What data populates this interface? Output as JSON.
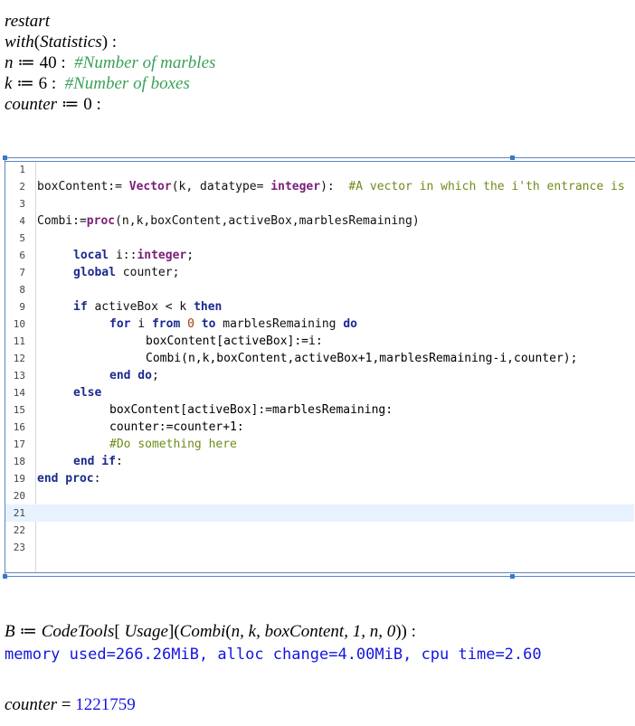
{
  "worksheet": {
    "line_restart": "restart",
    "line_with_cmd": "with",
    "line_with_arg": "Statistics",
    "n_var": "n",
    "n_val": "40",
    "n_comment": "#Number of marbles",
    "k_var": "k",
    "k_val": "6",
    "k_comment": "#Number of boxes",
    "counter_var": "counter",
    "counter_val": "0"
  },
  "code_editor": {
    "lines": [
      {
        "num": "1"
      },
      {
        "num": "2"
      },
      {
        "num": "3"
      },
      {
        "num": "4"
      },
      {
        "num": "5"
      },
      {
        "num": "6"
      },
      {
        "num": "7"
      },
      {
        "num": "8"
      },
      {
        "num": "9"
      },
      {
        "num": "10"
      },
      {
        "num": "11"
      },
      {
        "num": "12"
      },
      {
        "num": "13"
      },
      {
        "num": "14"
      },
      {
        "num": "15"
      },
      {
        "num": "16"
      },
      {
        "num": "17"
      },
      {
        "num": "18"
      },
      {
        "num": "19"
      },
      {
        "num": "20"
      },
      {
        "num": "21"
      },
      {
        "num": "22"
      },
      {
        "num": "23"
      }
    ],
    "l2_a": "boxContent:= ",
    "l2_b": "Vector",
    "l2_c": "(k, datatype= ",
    "l2_d": "integer",
    "l2_e": "):  ",
    "l2_f": "#A vector in which the i'th entrance is",
    "l4_a": "Combi:=",
    "l4_b": "proc",
    "l4_c": "(n,k,boxContent,activeBox,marblesRemaining)",
    "l6_a": "local",
    "l6_b": " i::",
    "l6_c": "integer",
    "l6_d": ";",
    "l7_a": "global",
    "l7_b": " counter;",
    "l9_a": "if",
    "l9_b": " activeBox < k ",
    "l9_c": "then",
    "l10_a": "for",
    "l10_b": " i ",
    "l10_c": "from",
    "l10_d": " 0 ",
    "l10_e": "to",
    "l10_f": " marblesRemaining ",
    "l10_g": "do",
    "l11_a": "boxContent[activeBox]:=i:",
    "l12_a": "Combi(n,k,boxContent,activeBox+1,marblesRemaining-i,counter);",
    "l13_a": "end do",
    "l13_b": ";",
    "l14_a": "else",
    "l15_a": "boxContent[activeBox]:=marblesRemaining:",
    "l16_a": "counter:=counter+1:",
    "l17_a": "#Do something here",
    "l18_a": "end if",
    "l18_b": ":",
    "l19_a": "end proc",
    "l19_b": ":"
  },
  "result": {
    "b_var": "B",
    "codetools": "CodeTools",
    "usage_index": "Usage",
    "combi_call": "Combi",
    "combi_args": "n, k, boxContent, 1, n, 0",
    "usage_output": "memory used=266.26MiB, alloc change=4.00MiB, cpu time=2.60",
    "counter_label": "counter",
    "counter_value": "1221759"
  }
}
